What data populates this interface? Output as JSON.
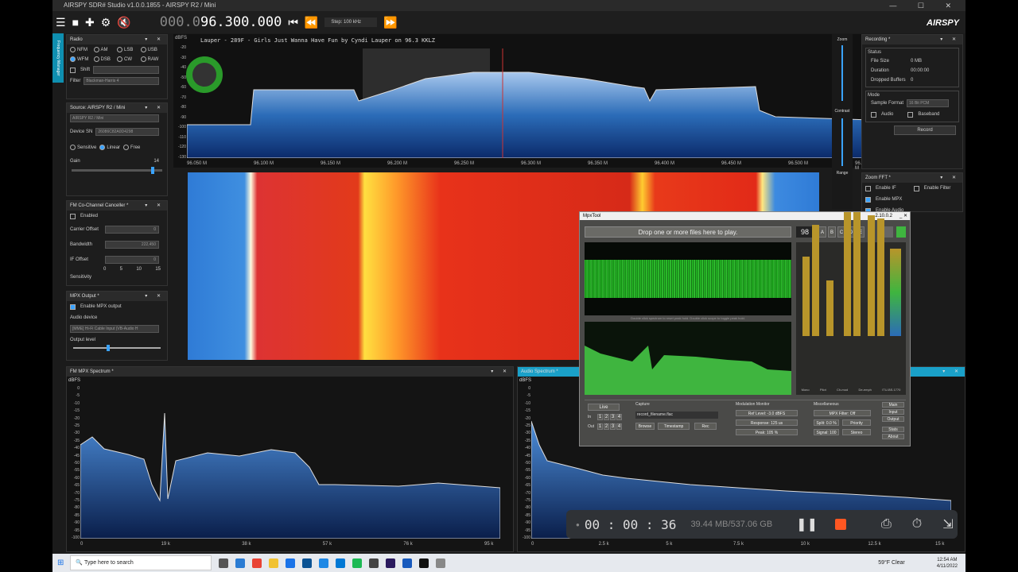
{
  "window": {
    "title": "AIRSPY SDR# Studio v1.0.0.1855 - AIRSPY R2 / Mini"
  },
  "toolbar": {
    "freq_dim": "000.0",
    "freq_main": "96.300.000",
    "step": "Step: 100 kHz",
    "logo": "AIRSPY"
  },
  "side_tab": "Frequency Manager",
  "radio": {
    "title": "Radio",
    "modes": [
      "NFM",
      "AM",
      "LSB",
      "USB",
      "WFM",
      "DSB",
      "CW",
      "RAW"
    ],
    "selected": "WFM",
    "shift": "Shift",
    "filter_label": "Filter",
    "filter_value": "Blackman-Harris 4"
  },
  "source": {
    "title": "Source: AIRSPY R2 / Mini",
    "device": "AIRSPY R2 / Mini",
    "sn_label": "Device SN",
    "sn_value": "26086C82A0D4298",
    "opt1": "Sensitive",
    "opt2": "Linear",
    "opt3": "Free",
    "gain_label": "Gain",
    "gain_value": "14"
  },
  "cochannel": {
    "title": "FM Co-Channel Canceller *",
    "enabled": "Enabled",
    "carrier_label": "Carrier Offset",
    "carrier_value": "0",
    "bandwidth_label": "Bandwidth",
    "bandwidth_value": "222,450",
    "if_label": "IF Offset",
    "if_value": "0",
    "sens_label": "Sensitivity",
    "ticks": [
      "0",
      "5",
      "10",
      "15"
    ]
  },
  "mpxout": {
    "title": "MPX Output *",
    "enable": "Enable MPX output",
    "audio_device": "Audio device",
    "device_value": "[MME] Hi-Fi Cable Input (VB-Audio H",
    "output_level": "Output level"
  },
  "spectrum": {
    "unit": "dBFS",
    "station": "Lauper  - 289F - Girls Just Wanna Have Fun by Cyndi Lauper on 96.3 KKLZ",
    "y_ticks": [
      "-20",
      "-30",
      "-40",
      "-50",
      "-60",
      "-70",
      "-80",
      "-90",
      "-100",
      "-110",
      "-120",
      "-130"
    ],
    "x_ticks": [
      "96.050 M",
      "96.100 M",
      "96.150 M",
      "96.200 M",
      "96.250 M",
      "96.300 M",
      "96.350 M",
      "96.400 M",
      "96.450 M",
      "96.500 M",
      "96.550 M"
    ]
  },
  "zoom": {
    "title": "Zoom",
    "contrast": "Contrast",
    "range": "Range",
    "value": "33"
  },
  "recording": {
    "title": "Recording *",
    "status": "Status",
    "file_size_label": "File Size",
    "file_size": "0 MB",
    "duration_label": "Duration",
    "duration": "00:00:00",
    "dropped_label": "Dropped Buffers",
    "dropped": "0",
    "mode": "Mode",
    "format_label": "Sample Format",
    "format_value": "16 Bit PCM",
    "audio": "Audio",
    "baseband": "Baseband",
    "record": "Record"
  },
  "zoomfft": {
    "title": "Zoom FFT *",
    "enable_if": "Enable IF",
    "enable_filter": "Enable Filter",
    "enable_mpx": "Enable MPX",
    "enable_audio": "Enable Audio"
  },
  "fm_mpx": {
    "title": "FM MPX Spectrum *",
    "unit": "dBFS",
    "y_ticks": [
      "0",
      "-5",
      "-10",
      "-15",
      "-20",
      "-25",
      "-30",
      "-35",
      "-40",
      "-45",
      "-50",
      "-55",
      "-60",
      "-65",
      "-70",
      "-75",
      "-80",
      "-85",
      "-90",
      "-95",
      "-100"
    ],
    "x_ticks": [
      "0",
      "19 k",
      "38 k",
      "57 k",
      "76 k",
      "95 k"
    ]
  },
  "audio_spec": {
    "title": "Audio Spectrum *",
    "unit": "dBFS",
    "y_ticks": [
      "0",
      "-5",
      "-10",
      "-15",
      "-20",
      "-25",
      "-30",
      "-35",
      "-40",
      "-45",
      "-50",
      "-55",
      "-60",
      "-65",
      "-70",
      "-75",
      "-80",
      "-85",
      "-90",
      "-95",
      "-100"
    ],
    "x_ticks": [
      "0",
      "2.5 k",
      "5 k",
      "7.5 k",
      "10 k",
      "12.5 k",
      "15 k"
    ]
  },
  "mpxtool": {
    "title": "MpxTool",
    "version": "2.10.0.2",
    "drop": "Drop one or more files here to play.",
    "counter": "98",
    "letters": [
      "A",
      "B",
      "C",
      "D",
      "E"
    ],
    "hint": "Double click spectrum to reset peak hold. Double click scope to toggle peak hold.",
    "meter_labels": [
      "Mono",
      "Pilot",
      "Ch-mod",
      "De-emph",
      "ITU-BS.1770"
    ],
    "live": "Live",
    "in": "In",
    "out": "Out",
    "nums": [
      "1",
      "2",
      "3",
      "4"
    ],
    "capture": "Capture",
    "filename": "record_filename.flac",
    "browse": "Browse",
    "timestamp": "Timestamp",
    "rec": "Rec",
    "modmon": "Modulation Monitor",
    "ref": "Ref Level: -3.0 dBFS",
    "resp": "Response: 125 us",
    "peak": "Peak: 105 %",
    "misc": "Miscellaneous",
    "filter": "MPX Filter: Off",
    "split": "Split: 0.0 %",
    "priority": "Priority",
    "signal": "Signal: 100",
    "stereo": "Stereo",
    "side": [
      "Main",
      "Input",
      "Output",
      "Stats",
      "About"
    ]
  },
  "recorder": {
    "time": "00 : 00 : 36",
    "size": "39.44 MB/537.06 GB"
  },
  "taskbar": {
    "search": "Type here to search",
    "weather": "59°F  Clear",
    "time": "12:54 AM",
    "date": "4/11/2022"
  },
  "colors": {
    "accent": "#3aa3ff",
    "spectrum_fill": "#2b6cb8",
    "mpx_green": "#3fb53f"
  }
}
